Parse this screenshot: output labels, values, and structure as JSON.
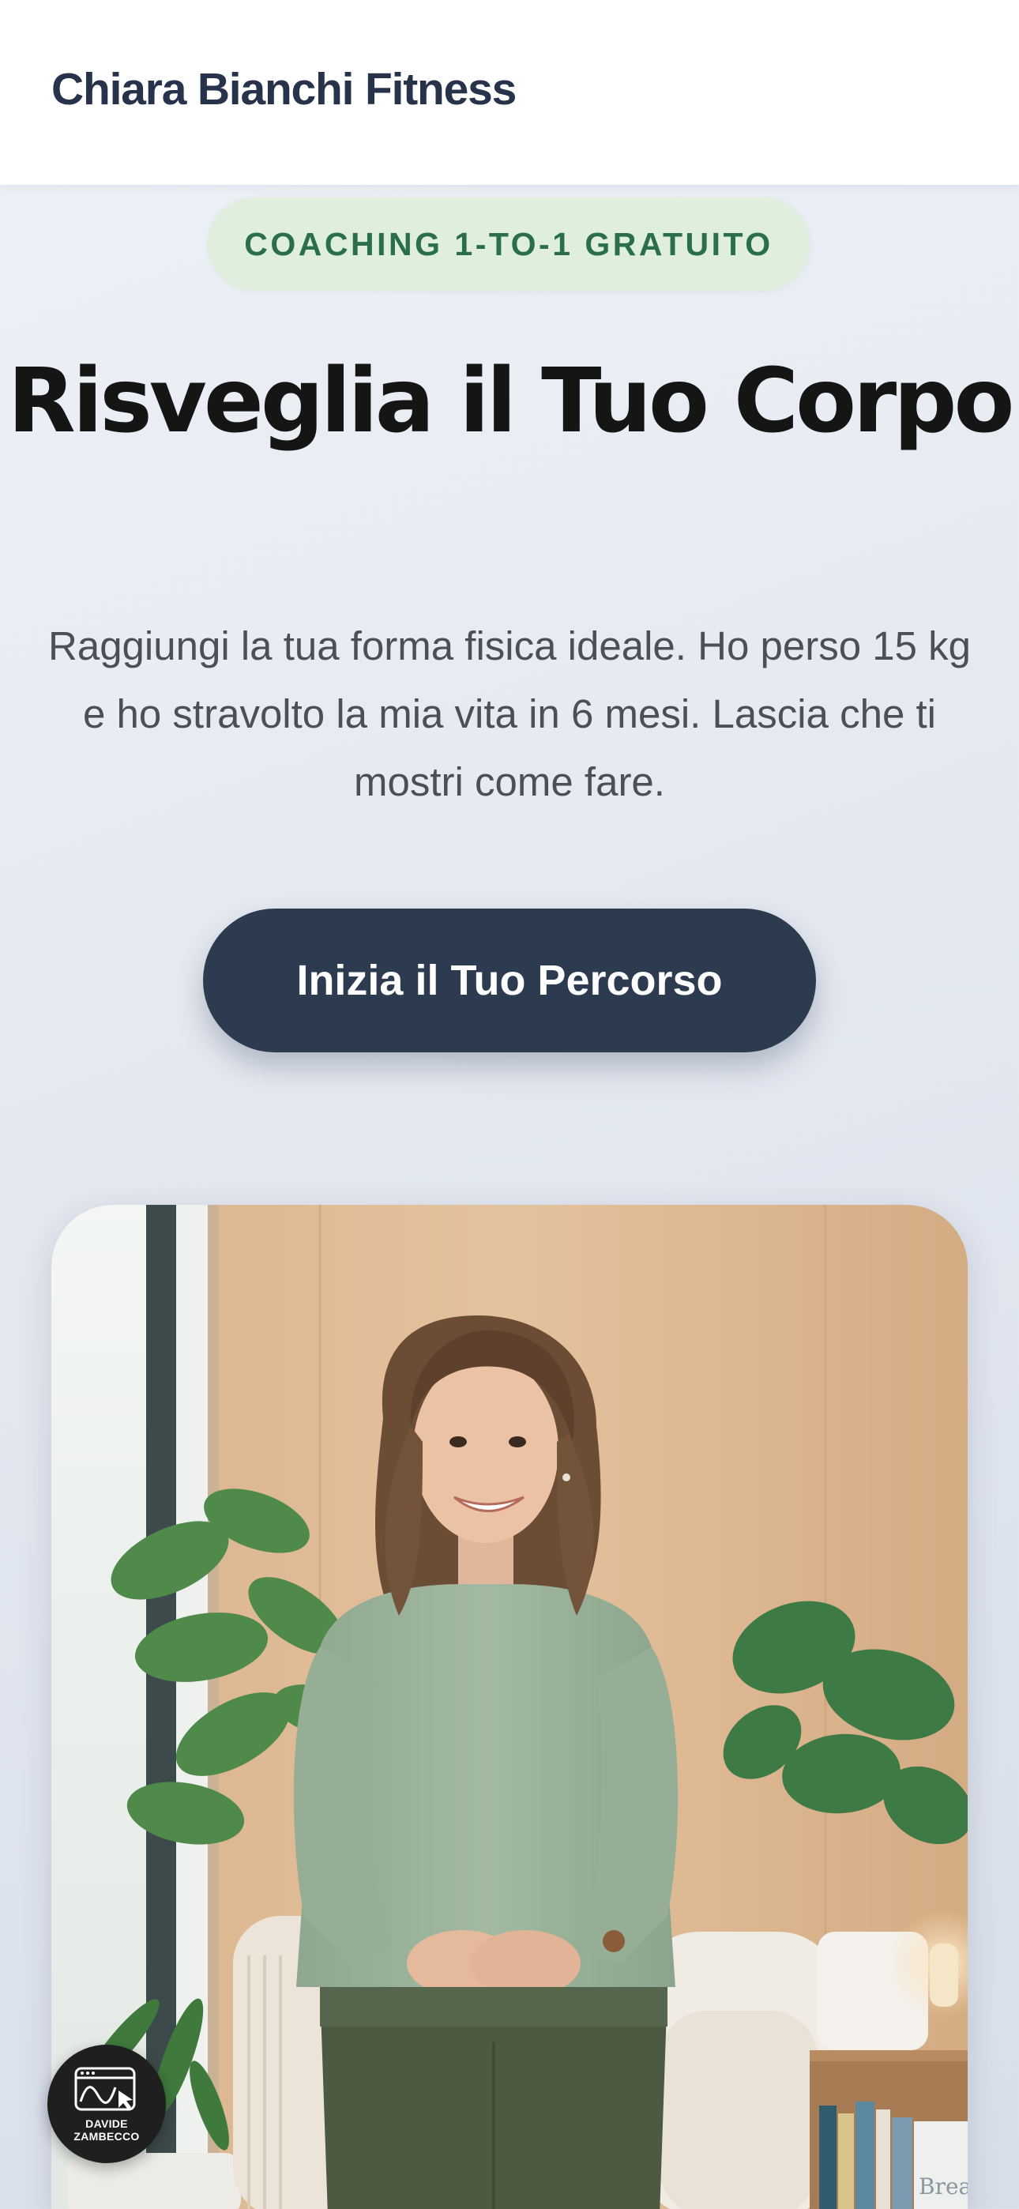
{
  "header": {
    "brand": "Chiara Bianchi Fitness"
  },
  "hero": {
    "badge": "COACHING 1-TO-1 GRATUITO",
    "title": "Risveglia il Tuo Corpo",
    "subtitle": "Raggiungi la tua forma fisica ideale. Ho perso 15 kg e ho stravolto la mia vita in 6 mesi. Lascia che ti mostri come fare.",
    "cta_label": "Inizia il Tuo Percorso"
  },
  "photo": {
    "book_spine_text": "Breat"
  },
  "widget": {
    "label": "DAVIDE\nZAMBECCO",
    "icon": "browser-chart-cursor-icon"
  },
  "colors": {
    "brand_text": "#27334a",
    "badge_bg": "#dfeedd",
    "badge_text": "#2b6e4c",
    "cta_bg": "#2c3b50",
    "page_bg": "#e4e9f1"
  }
}
